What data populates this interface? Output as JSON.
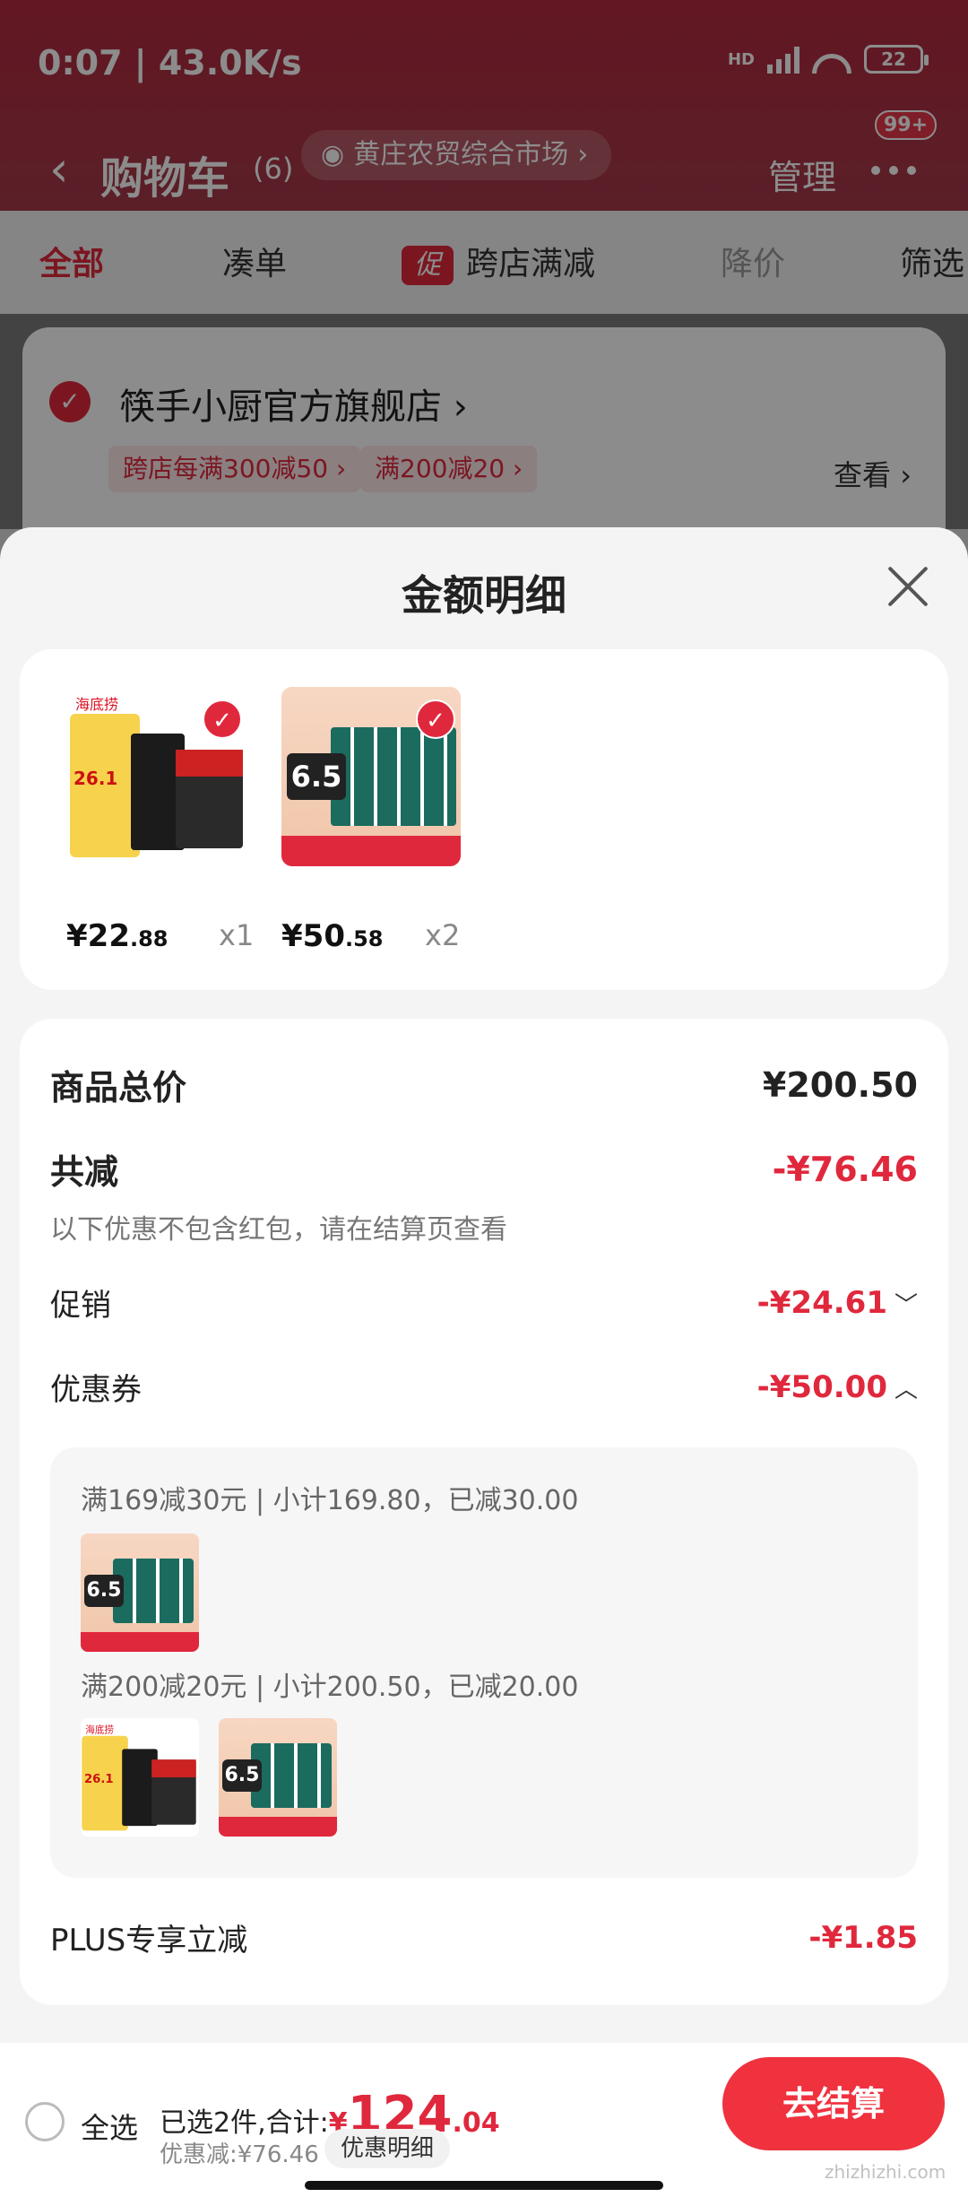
{
  "status_bar": {
    "time": "0:07 | 43.0K/s",
    "network": "HD",
    "battery": "22"
  },
  "header": {
    "title": "购物车",
    "count": "(6)",
    "market": "黄庄农贸综合市场",
    "manage": "管理",
    "badge": "99+"
  },
  "tabs": [
    {
      "label": "全部"
    },
    {
      "label": "凑单"
    },
    {
      "tag": "促",
      "label": "跨店满减"
    },
    {
      "label": "降价"
    },
    {
      "label": "筛选"
    }
  ],
  "store": {
    "name": "筷手小厨官方旗舰店",
    "chips": [
      "跨店每满300减50",
      "满200减20"
    ],
    "view": "查看"
  },
  "sheet": {
    "title": "金额明细",
    "products": [
      {
        "price_int": "¥22",
        "price_dec": ".88",
        "qty": "x1",
        "brand": "海底捞",
        "promo": "26.1"
      },
      {
        "price_int": "¥50",
        "price_dec": ".58",
        "qty": "x2",
        "promo": "6.5"
      }
    ],
    "total_label": "商品总价",
    "total_value": "¥200.50",
    "reduce_label": "共减",
    "reduce_value": "-¥76.46",
    "reduce_note": "以下优惠不包含红包，请在结算页查看",
    "promo_label": "促销",
    "promo_value": "-¥24.61",
    "coupon_label": "优惠券",
    "coupon_value": "-¥50.00",
    "coupon_lines": [
      "满169减30元 | 小计169.80，已减30.00",
      "满200减20元 | 小计200.50，已减20.00"
    ],
    "plus_label": "PLUS专享立减",
    "plus_value": "-¥1.85"
  },
  "bottom": {
    "select_all": "全选",
    "selected": "已选2件,合计:",
    "currency": "¥",
    "total_int": "124",
    "total_dec": ".04",
    "discount": "优惠减:¥76.46",
    "detail_button": "优惠明细",
    "checkout": "去结算"
  },
  "watermark": "zhizhizhi.com",
  "colors": {
    "accent": "#e0283d",
    "header": "#b32a3f"
  }
}
